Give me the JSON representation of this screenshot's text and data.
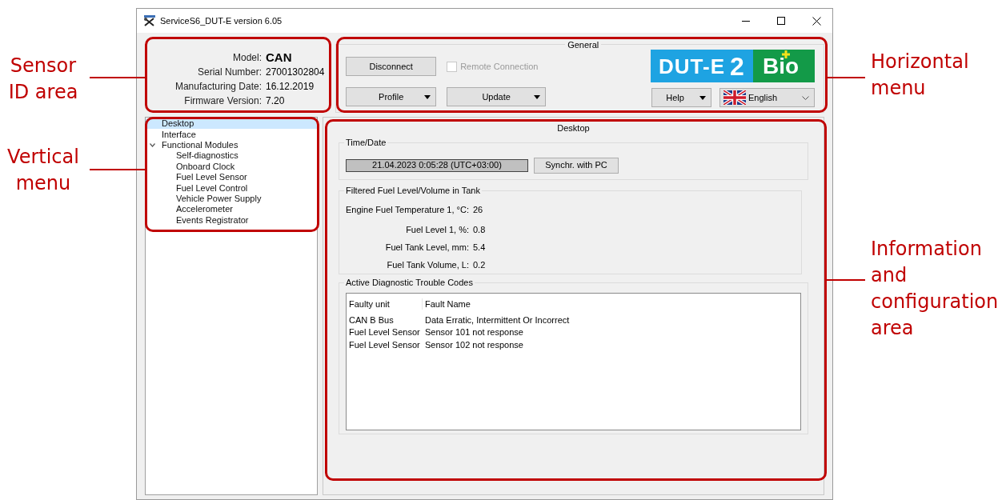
{
  "window": {
    "title": "ServiceS6_DUT-E version 6.05"
  },
  "sensor_info": [
    {
      "label": "Model:",
      "value": "CAN",
      "kind": "headline"
    },
    {
      "label": "Serial Number:",
      "value": "27001302804",
      "kind": "plain"
    },
    {
      "label": "Manufacturing Date:",
      "value": "16.12.2019",
      "kind": "plain"
    },
    {
      "label": "Firmware Version:",
      "value": "7.20",
      "kind": "plain"
    }
  ],
  "general": {
    "title": "General",
    "disconnect_button": "Disconnect",
    "remote_connection": {
      "label": "Remote Connection",
      "checked": false,
      "disabled": true
    },
    "profile_button": "Profile",
    "update_button": "Update",
    "logo": {
      "name": "DUT-E",
      "numeral": "2",
      "suffix": "Bio"
    },
    "help_button": "Help",
    "language": "English"
  },
  "tree": [
    {
      "label": "Desktop",
      "selected": true
    },
    {
      "label": "Interface",
      "selected": false
    },
    {
      "label": "Functional Modules",
      "selected": false,
      "expanded": true,
      "children": [
        {
          "label": "Self-diagnostics",
          "selected": false
        },
        {
          "label": "Onboard Clock",
          "selected": false
        },
        {
          "label": "Fuel Level Sensor",
          "selected": false
        },
        {
          "label": "Fuel Level Control",
          "selected": false
        },
        {
          "label": "Vehicle Power Supply",
          "selected": false
        },
        {
          "label": "Accelerometer",
          "selected": false
        },
        {
          "label": "Events Registrator",
          "selected": false
        }
      ]
    }
  ],
  "content": {
    "title": "Desktop",
    "time_date": {
      "title": "Time/Date",
      "value": "21.04.2023 0:05:28 (UTC+03:00)",
      "sync_button": "Synchr. with PC"
    },
    "fuel": {
      "title": "Filtered Fuel Level/Volume in Tank",
      "rows": [
        {
          "label": "Engine Fuel Temperature 1, °C:",
          "value": "26"
        },
        {
          "label": "Fuel Level 1, %:",
          "value": "0.8"
        },
        {
          "label": "Fuel Tank Level, mm:",
          "value": "5.4"
        },
        {
          "label": "Fuel Tank Volume, L:",
          "value": "0.2"
        }
      ]
    },
    "dtc": {
      "title": "Active Diagnostic Trouble Codes",
      "columns": [
        "Faulty unit",
        "Fault Name"
      ],
      "rows": [
        [
          "CAN B Bus",
          "Data Erratic, Intermittent Or Incorrect"
        ],
        [
          "Fuel Level Sensor",
          "Sensor 101 not response"
        ],
        [
          "Fuel Level Sensor",
          "Sensor 102 not response"
        ]
      ]
    }
  },
  "annotations": [
    {
      "text": "Sensor\nID area"
    },
    {
      "text": "Horizontal\nmenu"
    },
    {
      "text": "Vertical\nmenu"
    },
    {
      "text": "Information\nand\nconfiguration\narea"
    }
  ]
}
